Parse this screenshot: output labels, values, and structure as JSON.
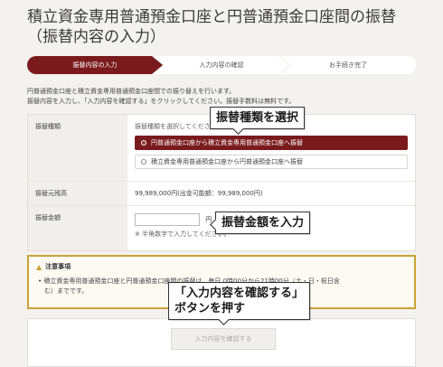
{
  "page": {
    "title_line1": "積立資金専用普通預金口座と円普通預金口座間の振替",
    "title_line2": "（振替内容の入力）"
  },
  "steps": [
    {
      "label": "振替内容の入力",
      "active": true
    },
    {
      "label": "入力内容の確認",
      "active": false
    },
    {
      "label": "お手続き完了",
      "active": false
    }
  ],
  "intro": {
    "line1": "円普通預金口座と積立資金専用普通預金口座間での振り替えを行います。",
    "line2": "振替内容を入力し、「入力内容を確認する」をクリックしてください。振替手数料は無料です。"
  },
  "form": {
    "transfer_type": {
      "label": "振替種類",
      "hint": "振替種類を選択してください。",
      "options": [
        {
          "label": "円普通預金口座から積立資金専用普通預金口座へ振替",
          "selected": true
        },
        {
          "label": "積立資金専用普通預金口座から円普通預金口座へ振替",
          "selected": false
        }
      ]
    },
    "balance": {
      "label": "振替元残高",
      "value": "99,989,000円(出金可能額：99,989,000円)"
    },
    "amount": {
      "label": "振替金額",
      "unit": "円",
      "hint": "※ 半角数字で入力してください。"
    }
  },
  "notice": {
    "title": "注意事項",
    "body_line1": "• 積立資金専用普通預金口座と円普通預金口座間の振替は、毎日 0時00分から21時00分（土・日・祝日含",
    "body_line2": "む）までです。"
  },
  "submit": {
    "label": "入力内容を確認する"
  },
  "callouts": {
    "select_type": "振替種類を選択",
    "enter_amount": "振替金額を入力",
    "press_button_line1": "「入力内容を確認する」",
    "press_button_line2": "ボタンを押す"
  },
  "colors": {
    "accent": "#7a1a1c",
    "warning": "#c9a136"
  }
}
